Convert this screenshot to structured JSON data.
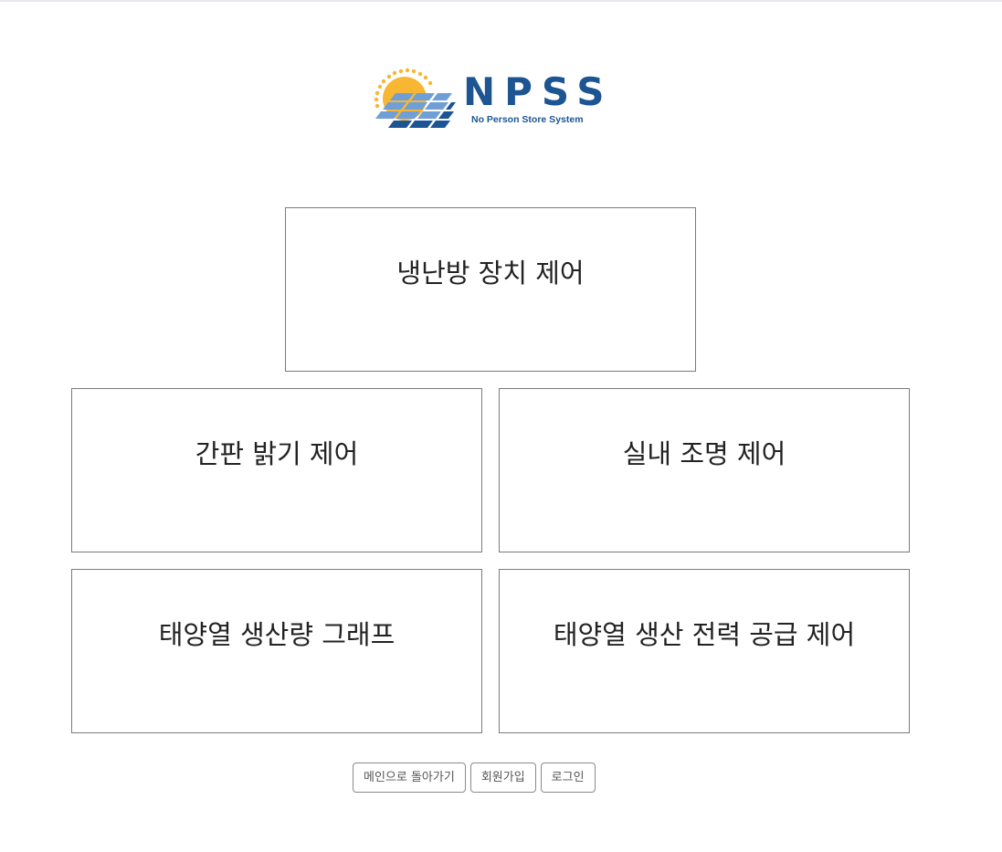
{
  "logo": {
    "title": "NPSS",
    "subtitle": "No Person Store System",
    "icon": "sun-solar-panel-logo",
    "colors": {
      "brand_blue": "#1c5592",
      "panel_light": "#6f9fd6",
      "sun": "#f7b733"
    }
  },
  "tiles": {
    "hvac": "냉난방 장치 제어",
    "sign": "간판 밝기 제어",
    "light": "실내 조명 제어",
    "graph": "태양열 생산량 그래프",
    "power": "태양열 생산 전력 공급 제어"
  },
  "buttons": {
    "main": "메인으로 돌아가기",
    "signup": "회원가입",
    "login": "로그인"
  }
}
